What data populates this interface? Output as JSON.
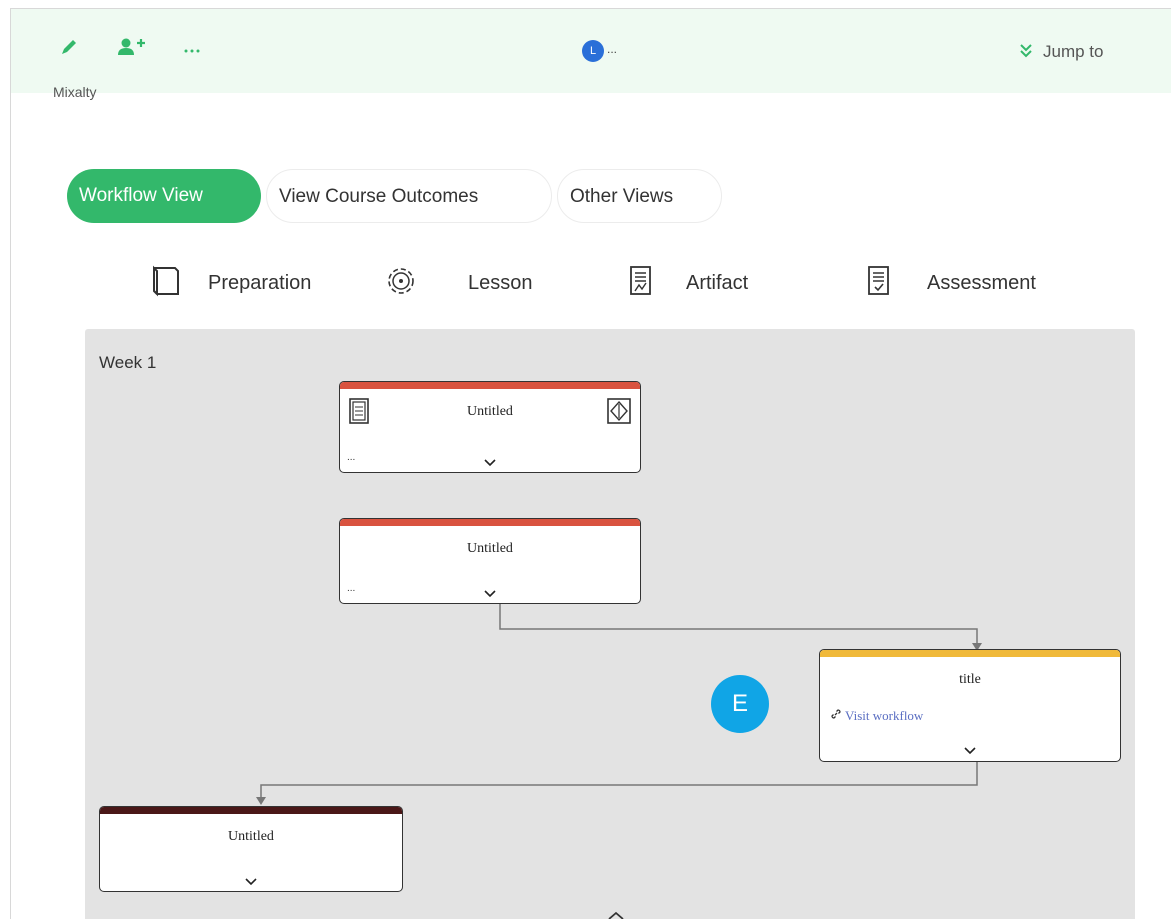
{
  "toolbar": {
    "avatar_initial": "L",
    "avatar_ellipsis": "...",
    "jump_label": "Jump to",
    "accent": "#33b86b"
  },
  "page": {
    "title_fragment": "Mixalty"
  },
  "view_tabs": [
    {
      "label": "Workflow View",
      "active": true
    },
    {
      "label": "View Course Outcomes",
      "active": false
    },
    {
      "label": "Other Views",
      "active": false
    }
  ],
  "legend": [
    {
      "label": "Preparation",
      "icon": "book-icon"
    },
    {
      "label": "Lesson",
      "icon": "gear-icon"
    },
    {
      "label": "Artifact",
      "icon": "chart-document-icon"
    },
    {
      "label": "Assessment",
      "icon": "checklist-icon"
    }
  ],
  "workflow": {
    "week_label": "Week 1",
    "nodes": [
      {
        "title": "Untitled",
        "bar_color": "#d9533f",
        "more": "..."
      },
      {
        "title": "Untitled",
        "bar_color": "#d9533f",
        "more": "..."
      },
      {
        "title": "title",
        "bar_color": "#f0b93a",
        "link": "Visit workflow"
      },
      {
        "title": "Untitled",
        "bar_color": "#4a1717"
      }
    ]
  },
  "badge": {
    "label": "E",
    "color": "#10a5e6"
  }
}
